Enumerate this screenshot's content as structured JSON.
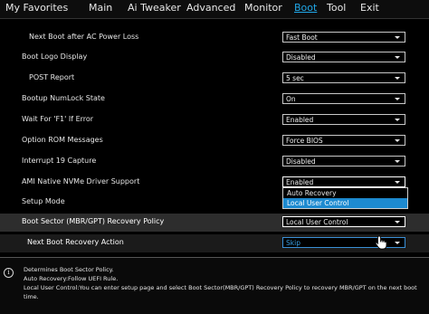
{
  "tabs": [
    {
      "label": "My Favorites",
      "active": false
    },
    {
      "label": "Main",
      "active": false
    },
    {
      "label": "Ai Tweaker",
      "active": false
    },
    {
      "label": "Advanced",
      "active": false
    },
    {
      "label": "Monitor",
      "active": false
    },
    {
      "label": "Boot",
      "active": true
    },
    {
      "label": "Tool",
      "active": false
    },
    {
      "label": "Exit",
      "active": false
    }
  ],
  "settings": [
    {
      "label": "Next Boot after AC Power Loss",
      "value": "Fast Boot"
    },
    {
      "label": "Boot Logo Display",
      "value": "Disabled"
    },
    {
      "label": "POST Report",
      "value": "5 sec"
    },
    {
      "label": "Bootup NumLock State",
      "value": "On"
    },
    {
      "label": "Wait For 'F1' If Error",
      "value": "Enabled"
    },
    {
      "label": "Option ROM Messages",
      "value": "Force BIOS"
    },
    {
      "label": "Interrupt 19 Capture",
      "value": "Disabled"
    },
    {
      "label": "AMI Native NVMe Driver Support",
      "value": "Enabled"
    },
    {
      "label": "Setup Mode",
      "value": ""
    },
    {
      "label": "Boot Sector (MBR/GPT) Recovery Policy",
      "value": "Local User Control"
    },
    {
      "label": "Next Boot Recovery Action",
      "value": "Skip"
    }
  ],
  "popup": {
    "options": [
      "Auto Recovery",
      "Local User Control"
    ],
    "selected_index": 1
  },
  "help": {
    "lines": [
      "Determines Boot Sector Policy.",
      "Auto Recovery:Follow UEFI Rule.",
      "Local User Control:You can enter setup page and select Boot Sector(MBR/GPT) Recovery Policy to recovery MBR/GPT on the next boot",
      "time."
    ]
  },
  "colors": {
    "accent": "#20a8e8",
    "popup_highlight": "#1d8ad0",
    "row_highlight": "#2d2d2d"
  },
  "icons": {
    "info": "info-icon",
    "cursor": "hand-pointer-icon",
    "dropdown": "dropdown-arrow-icon"
  },
  "info_glyph": "i"
}
